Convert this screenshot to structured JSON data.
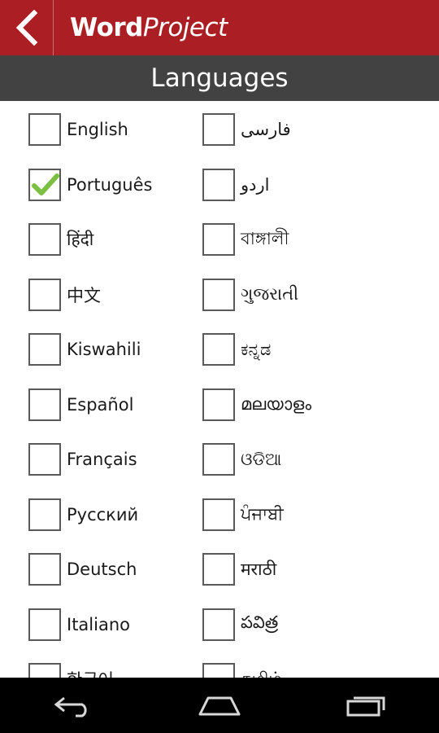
{
  "app": {
    "brand_bold": "Word",
    "brand_italic": "Project",
    "accent_color": "#ab1f24"
  },
  "header": {
    "title": "Languages"
  },
  "languages_left": [
    {
      "label": "English",
      "checked": false
    },
    {
      "label": "Português",
      "checked": true
    },
    {
      "label": "हिंदी",
      "checked": false
    },
    {
      "label": "中文",
      "checked": false
    },
    {
      "label": "Kiswahili",
      "checked": false
    },
    {
      "label": "Español",
      "checked": false
    },
    {
      "label": "Français",
      "checked": false
    },
    {
      "label": "Русский",
      "checked": false
    },
    {
      "label": "Deutsch",
      "checked": false
    },
    {
      "label": "Italiano",
      "checked": false
    },
    {
      "label": "한국어",
      "checked": false
    }
  ],
  "languages_right": [
    {
      "label": "فارسی",
      "checked": false
    },
    {
      "label": "اردو",
      "checked": false
    },
    {
      "label": "বাঙ্গালী",
      "checked": false
    },
    {
      "label": "ગુજરાતી",
      "checked": false
    },
    {
      "label": "ಕನ್ನಡ",
      "checked": false
    },
    {
      "label": "മലയാളം",
      "checked": false
    },
    {
      "label": "ଓଡିଆ",
      "checked": false
    },
    {
      "label": "ਪੰਜਾਬੀ",
      "checked": false
    },
    {
      "label": "मराठी",
      "checked": false
    },
    {
      "label": "పవిత్ర",
      "checked": false
    },
    {
      "label": "தமிழ்",
      "checked": false
    }
  ],
  "icons": {
    "back": "chevron-left-icon",
    "check": "checkmark-icon",
    "nav_back": "back-arrow-icon",
    "nav_home": "home-icon",
    "nav_recent": "recent-apps-icon"
  }
}
